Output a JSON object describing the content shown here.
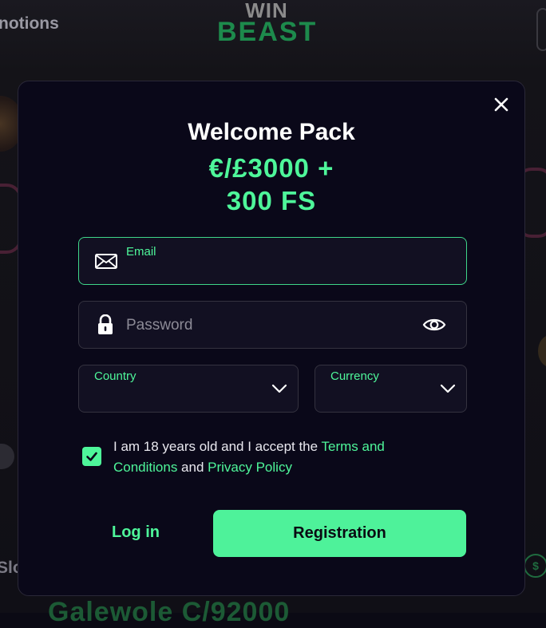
{
  "background": {
    "nav_promotions": "notions",
    "logo_line1": "WIN",
    "logo_line2": "BEAST",
    "slots_label": "Slo",
    "bottom_banner": "Galewole C/92000",
    "coin_symbol": "$"
  },
  "modal": {
    "close_icon": "close-icon",
    "title": "Welcome Pack",
    "bonus_line1": "€/£3000 +",
    "bonus_line2": "300 FS",
    "email": {
      "label": "Email",
      "value": "",
      "icon": "envelope-icon"
    },
    "password": {
      "placeholder": "Password",
      "value": "",
      "icon": "lock-icon",
      "toggle_icon": "eye-icon"
    },
    "country": {
      "label": "Country",
      "value": "",
      "icon": "chevron-down-icon"
    },
    "currency": {
      "label": "Currency",
      "value": "",
      "icon": "chevron-down-icon"
    },
    "consent": {
      "checked": true,
      "text_before": "I am 18 years old and I accept the ",
      "terms_link": "Terms and Conditions",
      "text_and": " and ",
      "privacy_link": "Privacy Policy"
    },
    "login_label": "Log in",
    "register_label": "Registration"
  },
  "colors": {
    "accent": "#4ef69a",
    "modal_bg": "#0a0819",
    "field_bg": "#121022",
    "text": "#ffffff",
    "placeholder": "#8c8a96"
  }
}
